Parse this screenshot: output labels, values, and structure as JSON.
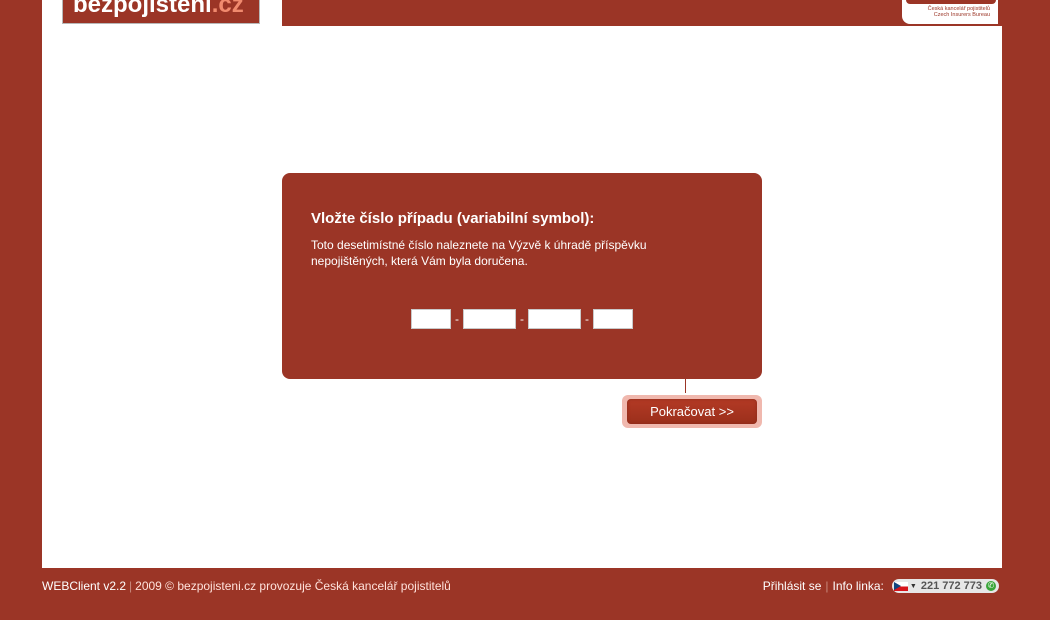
{
  "header": {
    "logo_main": "bezpojisteni",
    "logo_suffix": ".cz",
    "partner_line1": "Česká kancelář pojistitelů",
    "partner_line2": "Czech Insurers Bureau"
  },
  "form": {
    "title": "Vložte číslo případu (variabilní symbol):",
    "description": "Toto desetimístné číslo naleznete na Výzvě k úhradě příspěvku nepojištěných, která Vám byla doručena.",
    "field1": "",
    "field2": "",
    "field3": "",
    "field4": "",
    "separator": "-",
    "submit_label": "Pokračovat >>"
  },
  "footer": {
    "version": "WEBClient v2.2",
    "copyright": "2009 © bezpojisteni.cz provozuje Česká kancelář pojistitelů",
    "login_link": "Přihlásit se",
    "info_label": "Info linka:",
    "phone": "221 772 773"
  },
  "colors": {
    "brand": "#9b3526",
    "page": "#ffffff"
  }
}
